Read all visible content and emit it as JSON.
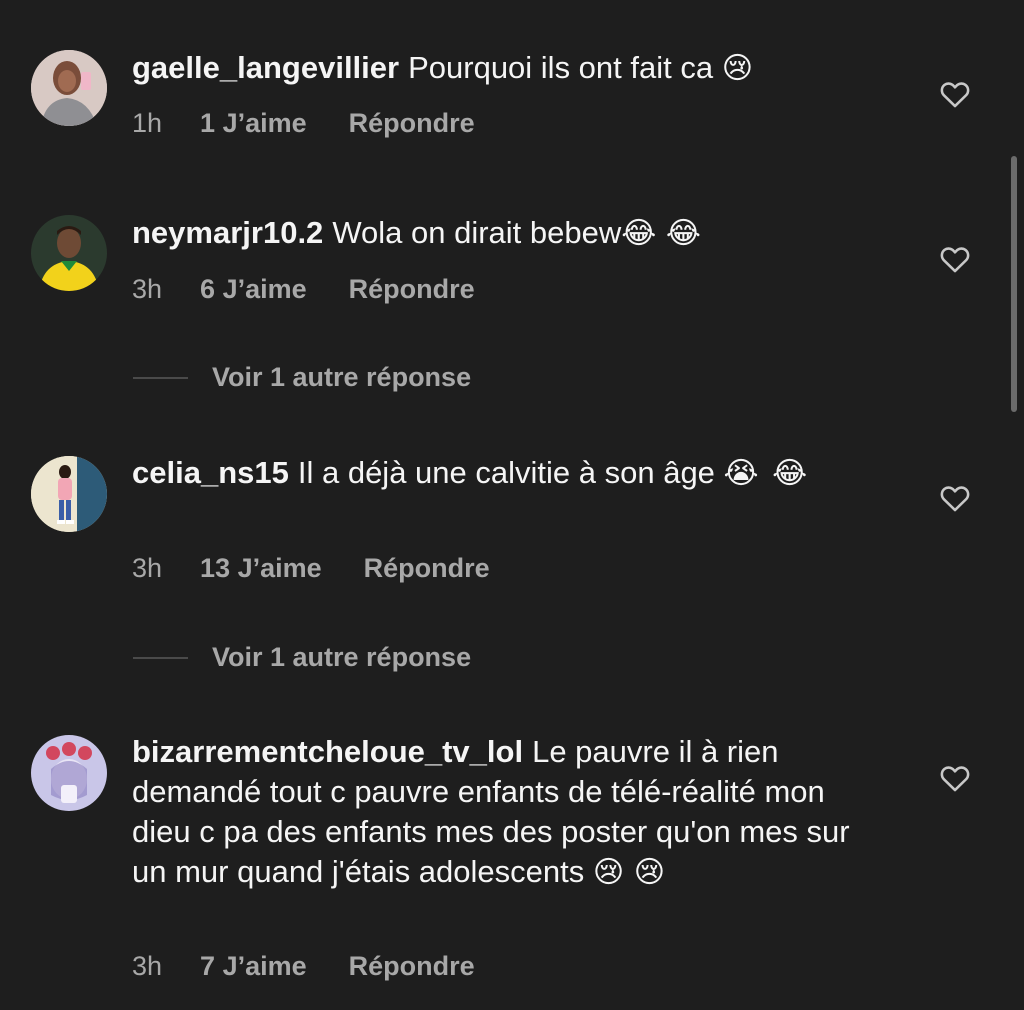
{
  "comments": [
    {
      "username": "gaelle_langevillier",
      "text": "Pourquoi ils ont fait ca",
      "emojis": "😢",
      "time": "1h",
      "likes": "1 J’aime",
      "reply": "Répondre"
    },
    {
      "username": "neymarjr10.2",
      "text": "Wola on dirait bebew",
      "emojis": "😂 😂",
      "time": "3h",
      "likes": "6 J’aime",
      "reply": "Répondre",
      "view_replies": "Voir 1 autre réponse"
    },
    {
      "username": "celia_ns15",
      "text": "Il a déjà une calvitie à son âge",
      "emojis": "😭 😂",
      "time": "3h",
      "likes": "13 J’aime",
      "reply": "Répondre",
      "view_replies": "Voir 1 autre réponse"
    },
    {
      "username": "bizarrementcheloue_tv_lol",
      "text": "Le pauvre il à rien demandé tout c pauvre enfants de télé-réalité mon dieu c pa des enfants mes des poster qu'on mes sur un mur quand j'étais adolescents",
      "emojis": "😢 😢",
      "time": "3h",
      "likes": "7 J’aime",
      "reply": "Répondre"
    }
  ],
  "icons": {
    "like": "heart-outline-icon"
  },
  "colors": {
    "background": "#1e1e1e",
    "text": "#f5f5f5",
    "secondary": "#a8a8a8"
  }
}
